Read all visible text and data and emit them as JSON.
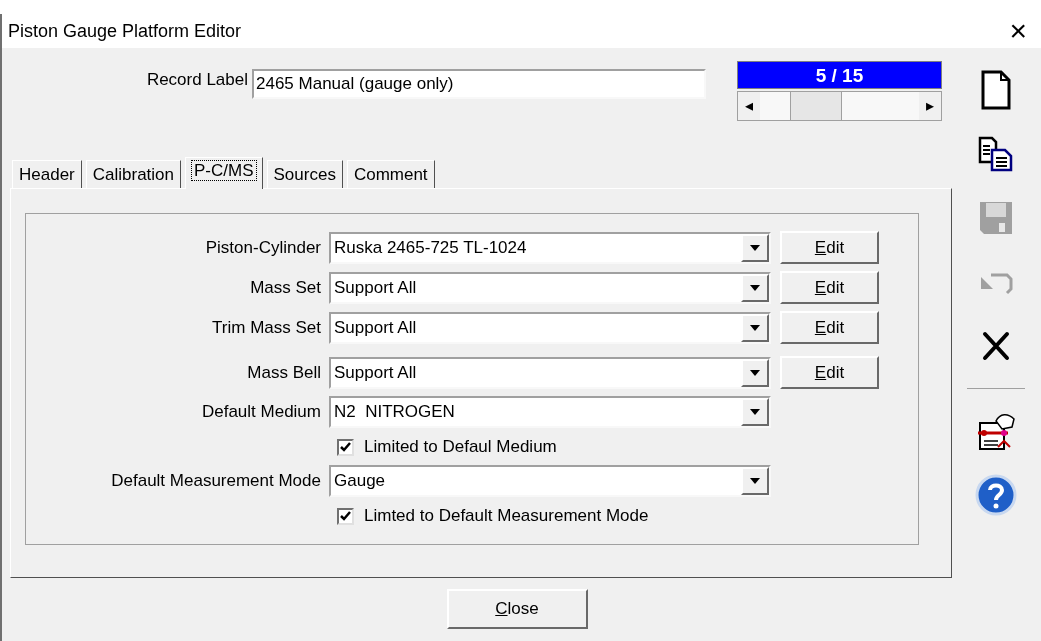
{
  "window": {
    "title": "Piston Gauge Platform Editor",
    "close": "×"
  },
  "record_label": {
    "label": "Record Label",
    "value": "2465 Manual (gauge only)"
  },
  "navigator": {
    "counter": "5 / 15",
    "left_arrow": "◂",
    "right_arrow": "▸"
  },
  "tabs": [
    {
      "label": "Header",
      "selected": false
    },
    {
      "label": "Calibration",
      "selected": false
    },
    {
      "label": "P-C/MS",
      "selected": true
    },
    {
      "label": "Sources",
      "selected": false
    },
    {
      "label": "Comment",
      "selected": false
    }
  ],
  "fields": [
    {
      "kind": "combo",
      "label": "Piston-Cylinder",
      "value": "Ruska 2465-725 TL-1024",
      "button": "Edit"
    },
    {
      "kind": "combo",
      "label": "Mass Set",
      "value": "Support All",
      "button": "Edit"
    },
    {
      "kind": "combo",
      "label": "Trim Mass Set",
      "value": "Support All",
      "button": "Edit"
    },
    {
      "kind": "combo",
      "label": "Mass Bell",
      "value": "Support All",
      "button": "Edit"
    },
    {
      "kind": "combo",
      "label": "Default Medium",
      "value": "N2  NITROGEN"
    },
    {
      "kind": "checkbox",
      "label": "Limited to Defaul Medium",
      "checked": true
    },
    {
      "kind": "combo",
      "label": "Default Measurement Mode",
      "value": "Gauge"
    },
    {
      "kind": "checkbox",
      "label": "Limted to Default Measurement Mode",
      "checked": true
    }
  ],
  "toolbar": [
    {
      "kind": "new",
      "disabled": false
    },
    {
      "kind": "copy",
      "disabled": false
    },
    {
      "kind": "save",
      "disabled": true
    },
    {
      "kind": "undo",
      "disabled": true
    },
    {
      "kind": "delete",
      "disabled": false
    },
    {
      "kind": "separator"
    },
    {
      "kind": "notebook",
      "disabled": false
    },
    {
      "kind": "help",
      "disabled": false
    }
  ],
  "close_button": "Close"
}
